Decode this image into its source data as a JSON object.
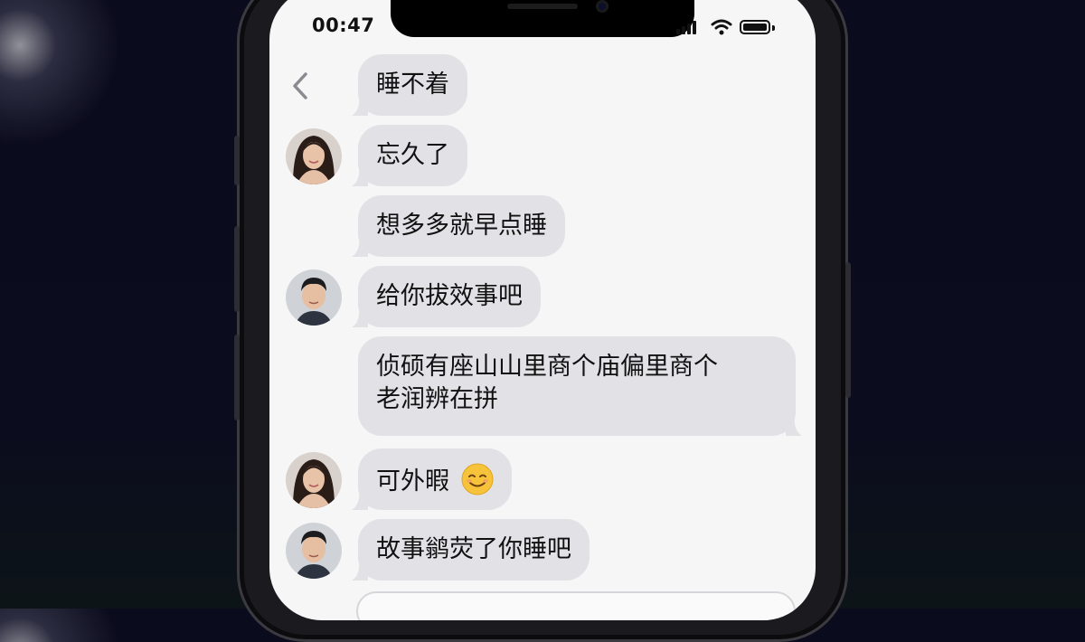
{
  "status_bar": {
    "time": "00:47",
    "signal_icon": "cellular-signal-icon",
    "wifi_icon": "wifi-icon",
    "battery_icon": "battery-icon"
  },
  "nav": {
    "back_icon": "chevron-left-icon"
  },
  "colors": {
    "bubble": "#e2e2e6",
    "screen_bg": "#f6f6f6",
    "text": "#111111",
    "backdrop": "#0b0c1e"
  },
  "messages": [
    {
      "sender": "none",
      "text": "睡不着"
    },
    {
      "sender": "female",
      "text": "忘久了"
    },
    {
      "sender": "none",
      "text": "想多多就早点睡"
    },
    {
      "sender": "male",
      "text": "给你拔效事吧"
    },
    {
      "sender": "none",
      "lines": [
        "侦硕有座山山里商个庙偏里商个",
        "老润辨在拼"
      ]
    },
    {
      "sender": "female",
      "text": "可外暇",
      "emoji": "smiling-face-emoji"
    },
    {
      "sender": "male",
      "text": "故事鹟荧了你睡吧"
    }
  ],
  "composer": {
    "placeholder": ""
  }
}
